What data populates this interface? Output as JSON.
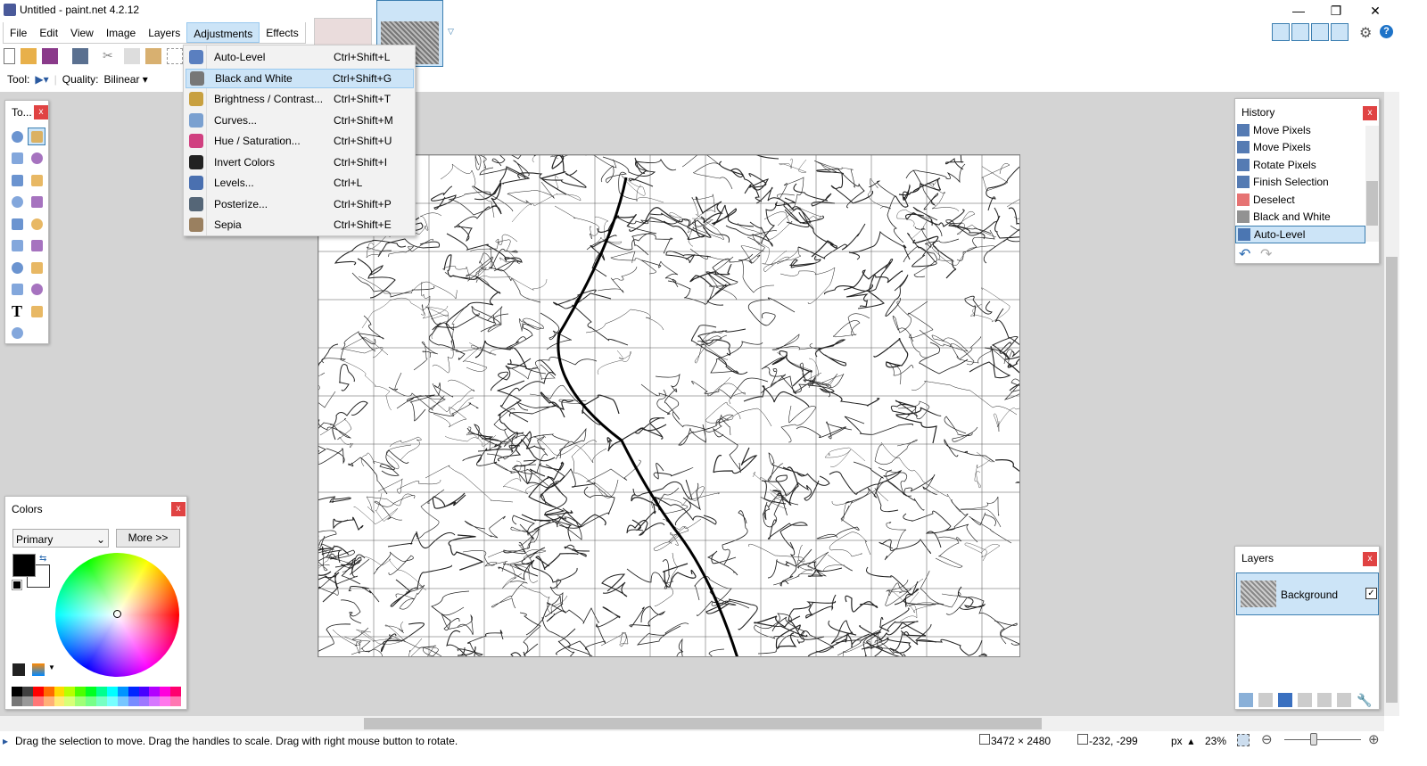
{
  "window": {
    "title": "Untitled - paint.net 4.2.12",
    "minimize": "—",
    "restore": "❐",
    "close": "✕"
  },
  "menu": [
    "File",
    "Edit",
    "View",
    "Image",
    "Layers",
    "Adjustments",
    "Effects"
  ],
  "toolbar": {
    "tool_label": "Tool:",
    "quality_label": "Quality:",
    "quality_value": "Bilinear"
  },
  "adjustments_menu": [
    {
      "label": "Auto-Level",
      "shortcut": "Ctrl+Shift+L",
      "icon": "auto-level-icon",
      "color": "#5a7fc0"
    },
    {
      "label": "Black and White",
      "shortcut": "Ctrl+Shift+G",
      "icon": "black-white-icon",
      "color": "#777777",
      "highlighted": true
    },
    {
      "label": "Brightness / Contrast...",
      "shortcut": "Ctrl+Shift+T",
      "icon": "brightness-icon",
      "color": "#c8a040"
    },
    {
      "label": "Curves...",
      "shortcut": "Ctrl+Shift+M",
      "icon": "curves-icon",
      "color": "#7aa0d0"
    },
    {
      "label": "Hue / Saturation...",
      "shortcut": "Ctrl+Shift+U",
      "icon": "hue-icon",
      "color": "#d04080"
    },
    {
      "label": "Invert Colors",
      "shortcut": "Ctrl+Shift+I",
      "icon": "invert-icon",
      "color": "#222222"
    },
    {
      "label": "Levels...",
      "shortcut": "Ctrl+L",
      "icon": "levels-icon",
      "color": "#4a70b0"
    },
    {
      "label": "Posterize...",
      "shortcut": "Ctrl+Shift+P",
      "icon": "posterize-icon",
      "color": "#556677"
    },
    {
      "label": "Sepia",
      "shortcut": "Ctrl+Shift+E",
      "icon": "sepia-icon",
      "color": "#9a8060"
    }
  ],
  "tools_panel": {
    "title": "To...",
    "close": "x"
  },
  "history": {
    "title": "History",
    "close": "x",
    "items": [
      {
        "label": "Move Pixels",
        "icon": "move-pixels-icon"
      },
      {
        "label": "Move Pixels",
        "icon": "move-pixels-icon"
      },
      {
        "label": "Rotate Pixels",
        "icon": "move-pixels-icon"
      },
      {
        "label": "Finish Selection",
        "icon": "move-pixels-icon"
      },
      {
        "label": "Deselect",
        "icon": "deselect-icon"
      },
      {
        "label": "Black and White",
        "icon": "black-white-icon"
      },
      {
        "label": "Auto-Level",
        "icon": "auto-level-icon",
        "selected": true
      }
    ],
    "undo": "↶",
    "redo": "↷"
  },
  "colors": {
    "title": "Colors",
    "close": "x",
    "mode": "Primary",
    "more_button": "More >>",
    "primary": "#000000",
    "secondary": "#ffffff"
  },
  "layers": {
    "title": "Layers",
    "close": "x",
    "items": [
      {
        "name": "Background",
        "visible": true
      }
    ]
  },
  "status": {
    "hint": "Drag the selection to move. Drag the handles to scale. Drag with right mouse button to rotate.",
    "image_size": "3472 × 2480",
    "cursor": "-232, -299",
    "units": "px",
    "zoom": "23%"
  },
  "palette": [
    "#000000",
    "#404040",
    "#ff0000",
    "#ff6a00",
    "#ffd800",
    "#b6ff00",
    "#4cff00",
    "#00ff21",
    "#00ff90",
    "#00ffff",
    "#0094ff",
    "#0026ff",
    "#4800ff",
    "#b200ff",
    "#ff00dc",
    "#ff006e"
  ]
}
